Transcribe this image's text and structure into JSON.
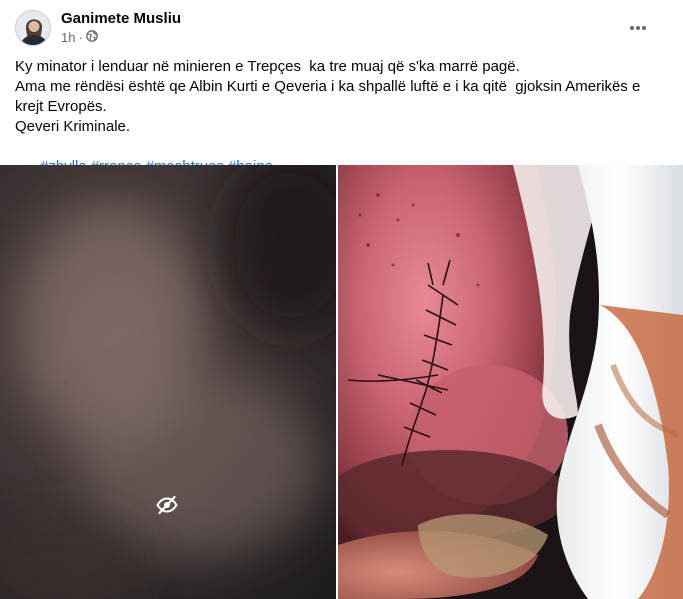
{
  "post": {
    "author": "Ganimete Musliu",
    "time": "1h",
    "time_separator": "·",
    "privacy_icon": "globe-icon",
    "more_icon": "more-horizontal-icon",
    "lines": [
      "Ky minator i lenduar në minieren e Trepçes  ka tre muaj që s'ka marrë pagë.",
      "Ama me rëndësi është qe Albin Kurti e Qeveria i ka shpallë luftë e i ka qitë  gjoksin Amerikës e krejt Evropës.",
      "Qeveri Kriminale."
    ],
    "hashtags": [
      "#zhylla",
      "#rrenca",
      "#mashtrues",
      "#hajna"
    ]
  },
  "media": {
    "left_image_icon": "hidden-eye-icon",
    "colors": {
      "hashtag": "#216fdb",
      "meta": "#65676b"
    }
  }
}
